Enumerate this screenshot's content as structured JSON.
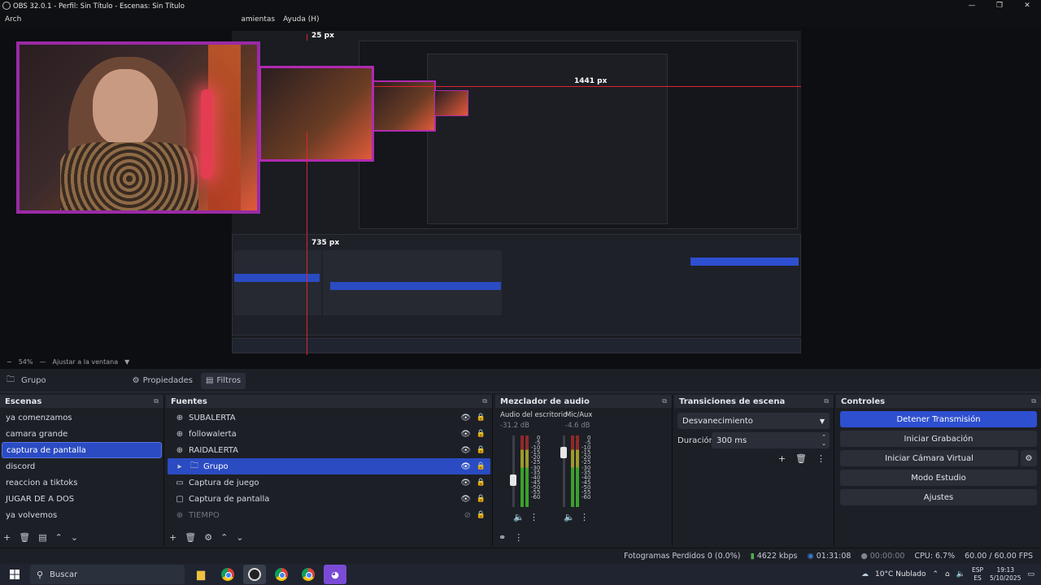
{
  "window": {
    "title": "OBS 32.0.1 - Perfil: Sin Título - Escenas: Sin Título"
  },
  "menu": {
    "items": [
      "Arch",
      "amientas",
      "Ayuda (H)"
    ]
  },
  "preview": {
    "measure_labels": [
      "25 px",
      "1441 px",
      "735 px"
    ],
    "zoom": "54%",
    "fit_label": "Ajustar a la ventana"
  },
  "context": {
    "source_name": "Grupo",
    "properties_label": "Propiedades",
    "filters_label": "Filtros"
  },
  "scenes": {
    "title": "Escenas",
    "items": [
      "ya comenzamos",
      "camara grande",
      "captura de pantalla",
      "discord",
      "reaccion a tiktoks",
      "JUGAR DE A DOS",
      "ya volvemos"
    ],
    "selected": "captura de pantalla"
  },
  "sources": {
    "title": "Fuentes",
    "items": [
      {
        "name": "SUBALERTA",
        "icon": "globe-icon"
      },
      {
        "name": "followalerta",
        "icon": "globe-icon"
      },
      {
        "name": "RAIDALERTA",
        "icon": "globe-icon"
      },
      {
        "name": "Grupo",
        "icon": "folder-icon"
      },
      {
        "name": "Captura de juego",
        "icon": "gamepad-icon"
      },
      {
        "name": "Captura de pantalla",
        "icon": "monitor-icon"
      },
      {
        "name": "TIEMPO",
        "icon": "globe-icon"
      }
    ],
    "selected": "Grupo"
  },
  "mixer": {
    "title": "Mezclador de audio",
    "channels": [
      {
        "name": "Audio del escritorio",
        "db": "-31.2 dB"
      },
      {
        "name": "Mic/Aux",
        "db": "-4.6 dB"
      }
    ],
    "scale": [
      "0",
      "-5",
      "-10",
      "-15",
      "-20",
      "-25",
      "-30",
      "-35",
      "-40",
      "-45",
      "-50",
      "-55",
      "-60"
    ]
  },
  "transitions": {
    "title": "Transiciones de escena",
    "current": "Desvanecimiento",
    "duration_label": "Duración",
    "duration_value": "300 ms"
  },
  "controls": {
    "title": "Controles",
    "stop_stream": "Detener Transmisión",
    "start_rec": "Iniciar Grabación",
    "start_vcam": "Iniciar Cámara Virtual",
    "studio_mode": "Modo Estudio",
    "settings": "Ajustes"
  },
  "status": {
    "dropped": "Fotogramas Perdidos 0 (0.0%)",
    "bitrate": "4622 kbps",
    "stream_time": "01:31:08",
    "rec_time": "00:00:00",
    "cpu": "CPU: 6.7%",
    "fps": "60.00 / 60.00 FPS"
  },
  "taskbar": {
    "search_placeholder": "Buscar",
    "weather": "10°C  Nublado",
    "lang1": "ESP",
    "lang2": "ES",
    "time": "19:13",
    "date": "5/10/2025"
  },
  "colors": {
    "accent": "#2d4fd0",
    "measure": "#e0232e",
    "border": "#9a2aa6"
  }
}
